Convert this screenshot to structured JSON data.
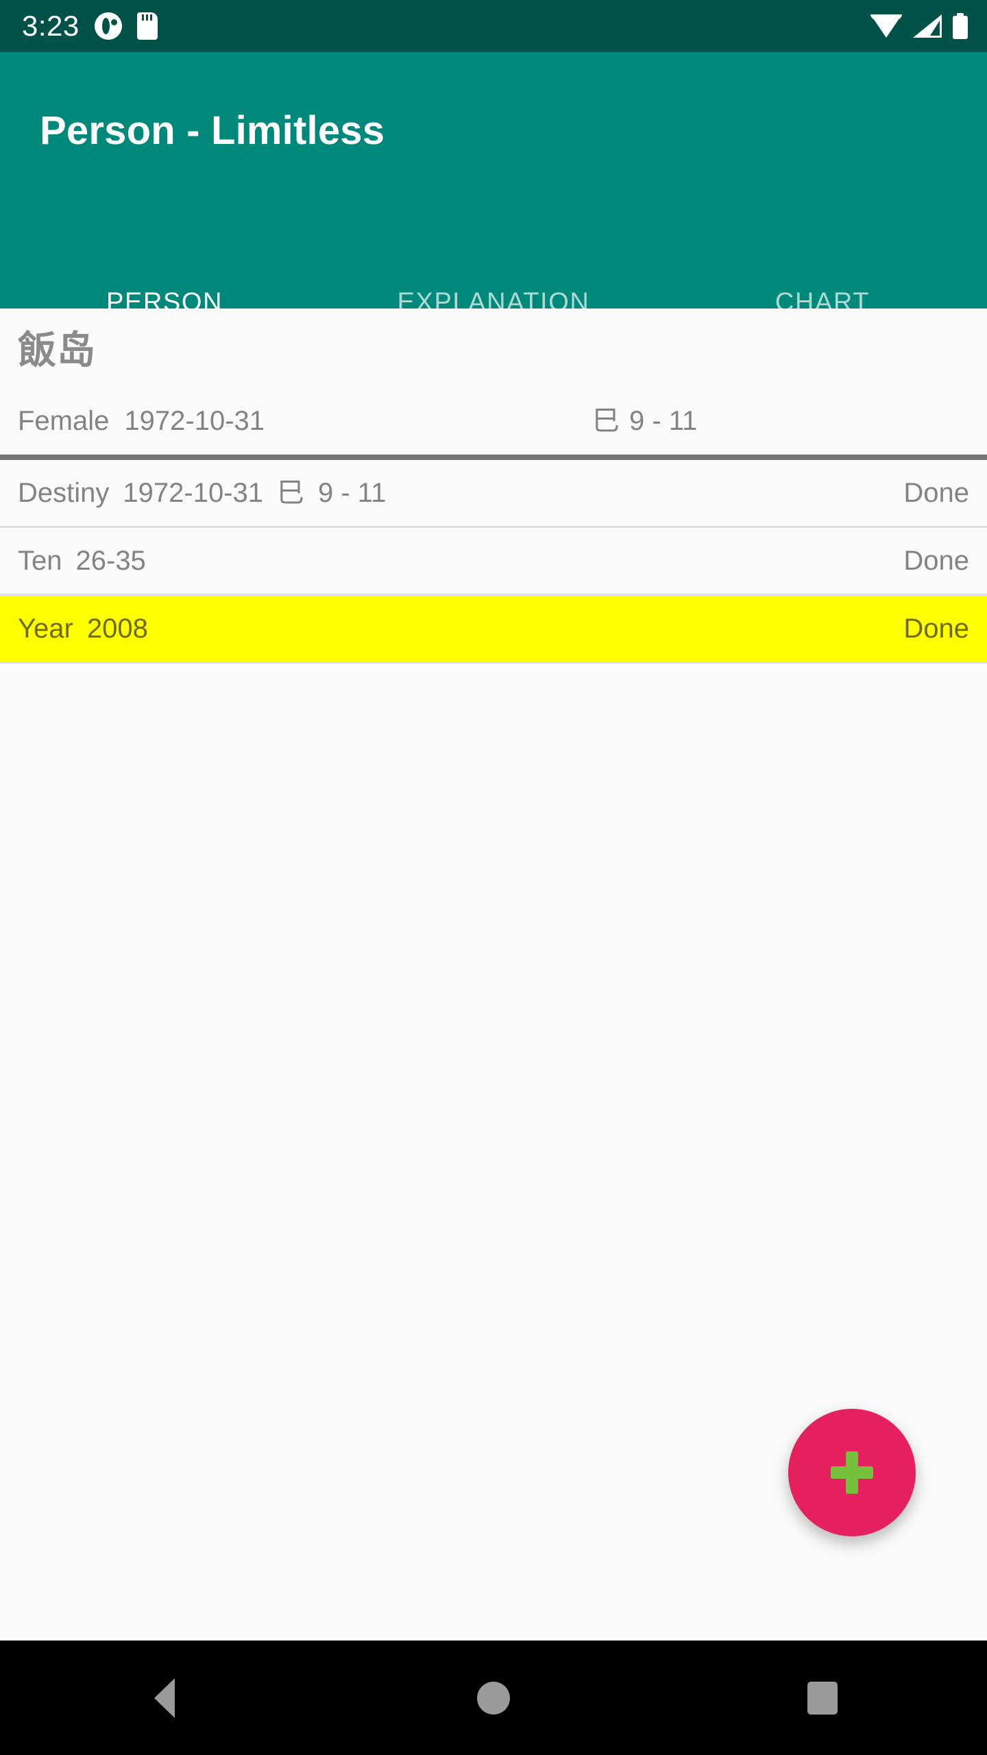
{
  "status_bar": {
    "time": "3:23",
    "left_icons": [
      "notification-icon",
      "sd-card-icon"
    ],
    "right_icons": [
      "wifi-icon",
      "cellular-signal-icon",
      "battery-icon"
    ],
    "background_color": "#005249"
  },
  "app_bar": {
    "title": "Person - Limitless",
    "background_color": "#00897B",
    "title_color": "#FFFFFF"
  },
  "tabs": {
    "indicator_color": "#E5205F",
    "active_index": 0,
    "items": [
      {
        "label": "PERSON"
      },
      {
        "label": "EXPLANATION"
      },
      {
        "label": "CHART"
      }
    ]
  },
  "person_header": {
    "name": "飯岛",
    "gender": "Female",
    "birth_date": "1972-10-31",
    "zodiac_glyph": "巳",
    "zodiac_hours": "9 - 11"
  },
  "list": {
    "rows": [
      {
        "label": "Destiny",
        "value": "1972-10-31",
        "glyph": "巳",
        "extra": "9 - 11",
        "status": "Done",
        "highlight": false
      },
      {
        "label": "Ten",
        "value": "26-35",
        "glyph": "",
        "extra": "",
        "status": "Done",
        "highlight": false
      },
      {
        "label": "Year",
        "value": "2008",
        "glyph": "",
        "extra": "",
        "status": "Done",
        "highlight": true
      }
    ],
    "highlight_color": "#FFFF00",
    "divider_color": "#DEDEDE",
    "header_divider_color": "#767676"
  },
  "fab": {
    "icon": "plus-icon",
    "background_color": "#E5205F",
    "icon_color": "#76C13C"
  },
  "nav_bar": {
    "background_color": "#000000",
    "buttons": [
      "back-icon",
      "home-icon",
      "recents-icon"
    ]
  }
}
